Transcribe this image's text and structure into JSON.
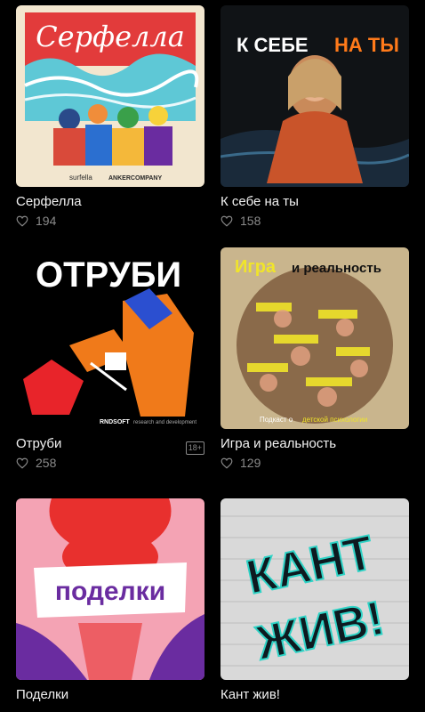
{
  "podcasts": [
    {
      "title": "Серфелла",
      "likes": "194",
      "cover_text": "Серфелла",
      "cover_brand_left": "surfella",
      "cover_brand_right": "ANKERCOMPANY",
      "colors": {
        "sky": "#e23b3b",
        "sea": "#5ec8d6",
        "sand": "#f2e6cf"
      }
    },
    {
      "title": "К себе на ты",
      "likes": "158",
      "cover_text_a": "К СЕБЕ",
      "cover_text_b": "НА ТЫ",
      "colors": {
        "bg": "#101316",
        "accent": "#ff7a1a",
        "dress": "#c9542a"
      }
    },
    {
      "title": "Отруби",
      "likes": "258",
      "cover_text": "ОТРУБИ",
      "cover_footer": "RNDSOFT",
      "cover_footer_sub": "research and development",
      "age_badge": "18+",
      "colors": {
        "bg": "#000000",
        "red": "#e8242a",
        "orange": "#f07a1a",
        "blue": "#2b4fd0"
      }
    },
    {
      "title": "Игра и реальность",
      "likes": "129",
      "cover_text_a": "Игра",
      "cover_text_b": "и реальность",
      "cover_caption_a": "Подкаст о",
      "cover_caption_b": "детской психологии",
      "colors": {
        "bg": "#c9b58d",
        "accent": "#f0e52a"
      }
    },
    {
      "title": "Поделки",
      "likes": "",
      "cover_text": "поделки",
      "colors": {
        "bg": "#f4a3b4",
        "purple": "#6a2ca0",
        "red": "#e8302e"
      }
    },
    {
      "title": "Кант жив!",
      "likes": "",
      "cover_text_a": "КАНТ",
      "cover_text_b": "ЖИВ!",
      "colors": {
        "bg": "#d9d9d9",
        "text": "#0e1a20",
        "glow": "#2fd3c6"
      }
    }
  ],
  "icons": {
    "likes": "heart-icon"
  }
}
